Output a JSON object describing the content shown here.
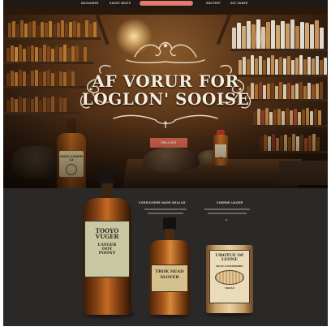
{
  "nav": {
    "items": [
      "MAGANNER",
      "SANCE NEATS",
      "SMOTENT",
      "SNT ANNER"
    ],
    "colors": {
      "bar": "#1f1a16",
      "pill": "#e07b6e"
    }
  },
  "hero": {
    "title_line1": "AF VORUR FOR",
    "title_line2": "LOGLON' SOOISE",
    "cta_label": "ERO A VATE",
    "left_label_line1": "MAN LADER",
    "left_label_line2": "LA",
    "right_label": "M",
    "colors": {
      "cta": "#e16a57",
      "title": "#f6ecdc"
    }
  },
  "products": {
    "col2_title": "VORDIOVERE NAGE NEALUS",
    "col3_title": "VUERNE UAOER",
    "chevron_icon": "chevron-down-icon",
    "bottle1": {
      "line1": "TOOYO VUGER",
      "line2": "LAYGER",
      "line3": "OOY",
      "line4": "POONT"
    },
    "bottle2": {
      "line1": "TROK NEAD",
      "line2": "SLOVER"
    },
    "tin": {
      "line1": "UHOTUE OF LEONE",
      "line2": "RUSE GOTOHORRE",
      "line3": "VROAE"
    }
  }
}
